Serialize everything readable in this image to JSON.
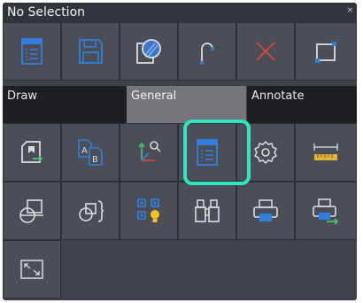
{
  "window": {
    "title": "No Selection",
    "close_glyph": "×"
  },
  "tabs": [
    "Draw",
    "General",
    "Annotate"
  ],
  "row1_icons": [
    "properties-panel-icon",
    "save-icon",
    "hatch-icon",
    "arc-icon",
    "delete-icon",
    "rectangle-icon"
  ],
  "row3_icons": [
    "insert-block-icon",
    "text-style-icon",
    "ucs-icon",
    "properties-panel-icon",
    "settings-gear-icon",
    "measure-ruler-icon"
  ],
  "row4_icons": [
    "copy-shape-icon",
    "group-icon",
    "layers-bulb-icon",
    "find-binoculars-icon",
    "print-icon",
    "print-export-icon"
  ],
  "row5_icons": [
    "fullscreen-icon"
  ],
  "colors": {
    "highlight": "#2fe6bd",
    "accent_blue": "#2f7fe0",
    "delete_red": "#e0443a"
  }
}
